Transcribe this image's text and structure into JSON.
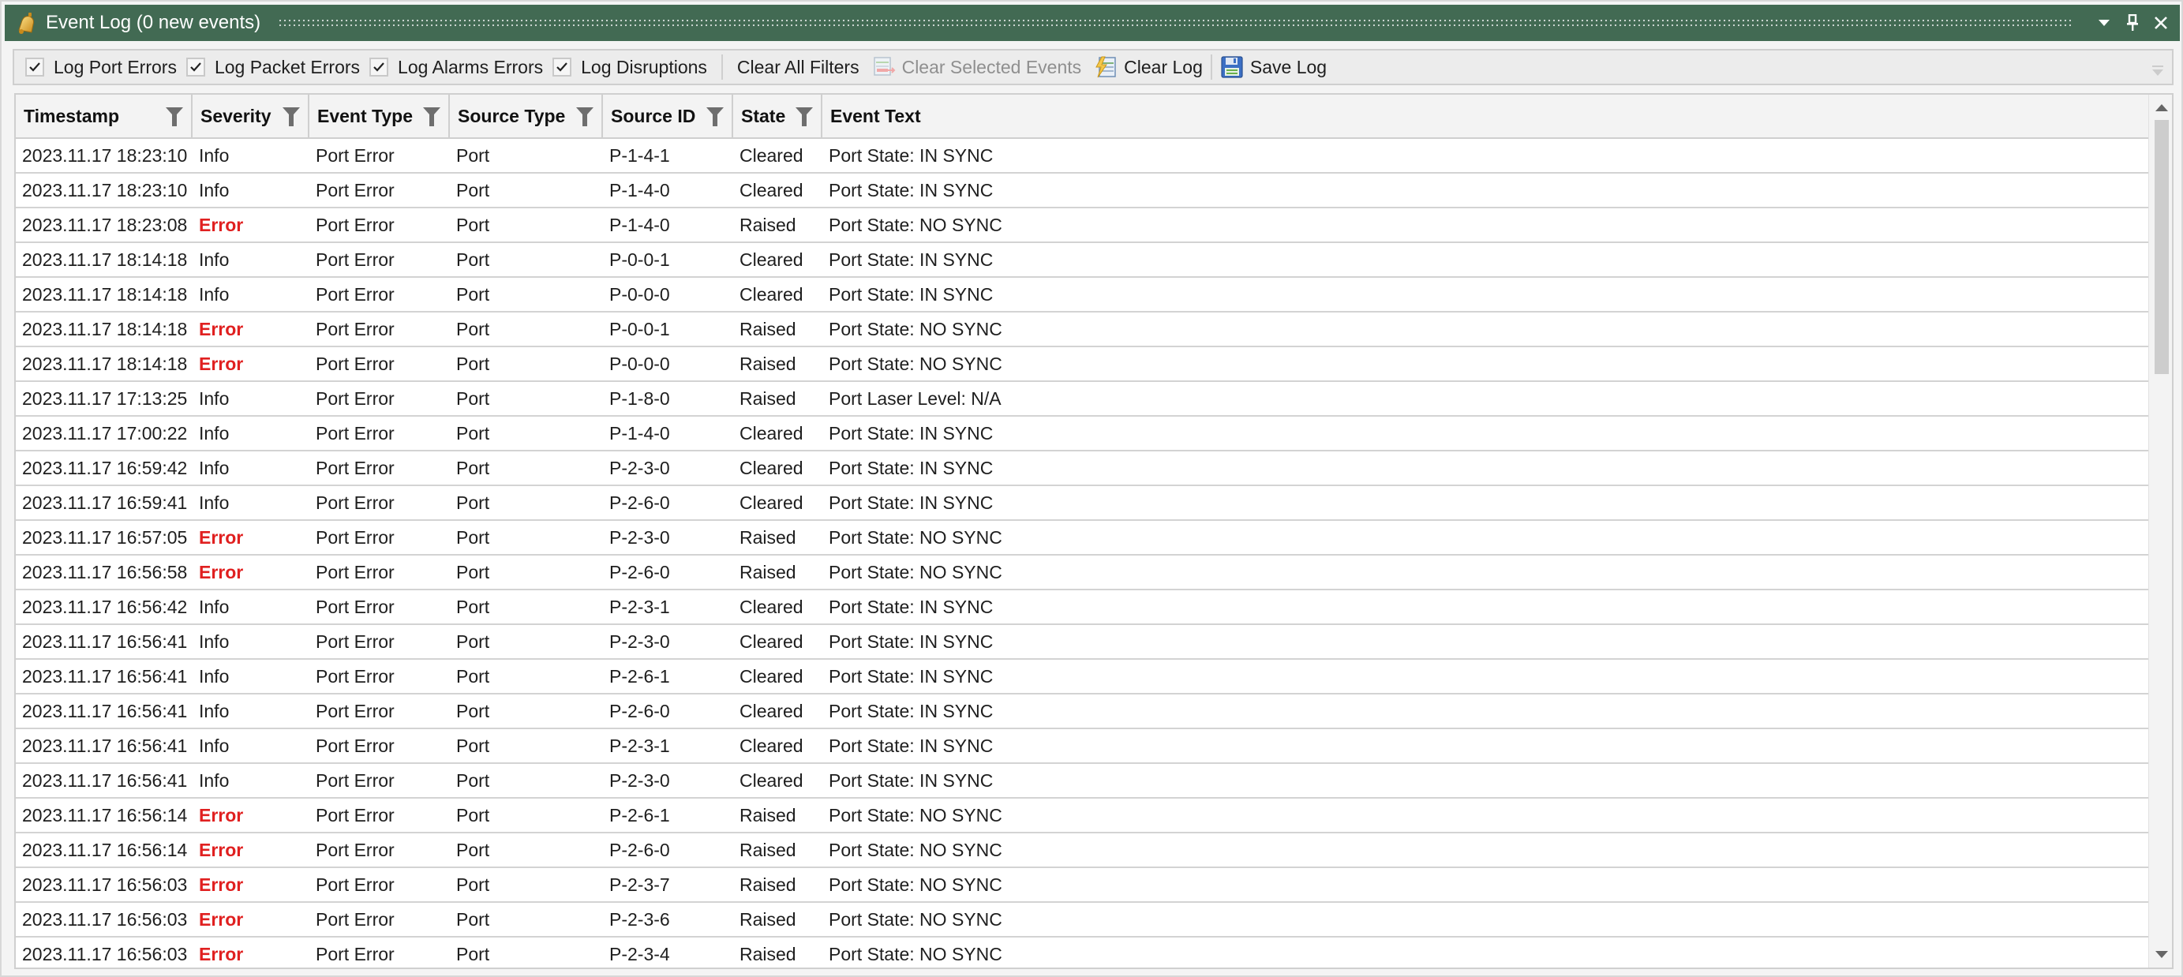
{
  "window": {
    "title": "Event Log (0 new events)",
    "title_icon": "bell-icon",
    "colors": {
      "titlebar": "#426a53",
      "error_text": "#e02020"
    }
  },
  "title_buttons": [
    {
      "name": "dropdown-button",
      "icon": "chevron-down-icon"
    },
    {
      "name": "pin-button",
      "icon": "pin-icon"
    },
    {
      "name": "close-button",
      "icon": "close-icon"
    }
  ],
  "toolbar": {
    "checkboxes": [
      {
        "label": "Log Port Errors",
        "checked": true
      },
      {
        "label": "Log Packet Errors",
        "checked": true
      },
      {
        "label": "Log Alarms Errors",
        "checked": true
      },
      {
        "label": "Log Disruptions",
        "checked": true
      }
    ],
    "clear_all_filters": "Clear All Filters",
    "clear_selected_events": "Clear Selected Events",
    "clear_selected_events_enabled": false,
    "clear_log": "Clear Log",
    "save_log": "Save Log"
  },
  "table": {
    "columns": [
      "Timestamp",
      "Severity",
      "Event Type",
      "Source Type",
      "Source ID",
      "State",
      "Event Text"
    ],
    "rows": [
      [
        "2023.11.17 18:23:10",
        "Info",
        "Port Error",
        "Port",
        "P-1-4-1",
        "Cleared",
        "Port State: IN SYNC"
      ],
      [
        "2023.11.17 18:23:10",
        "Info",
        "Port Error",
        "Port",
        "P-1-4-0",
        "Cleared",
        "Port State: IN SYNC"
      ],
      [
        "2023.11.17 18:23:08",
        "Error",
        "Port Error",
        "Port",
        "P-1-4-0",
        "Raised",
        "Port State: NO SYNC"
      ],
      [
        "2023.11.17 18:14:18",
        "Info",
        "Port Error",
        "Port",
        "P-0-0-1",
        "Cleared",
        "Port State: IN SYNC"
      ],
      [
        "2023.11.17 18:14:18",
        "Info",
        "Port Error",
        "Port",
        "P-0-0-0",
        "Cleared",
        "Port State: IN SYNC"
      ],
      [
        "2023.11.17 18:14:18",
        "Error",
        "Port Error",
        "Port",
        "P-0-0-1",
        "Raised",
        "Port State: NO SYNC"
      ],
      [
        "2023.11.17 18:14:18",
        "Error",
        "Port Error",
        "Port",
        "P-0-0-0",
        "Raised",
        "Port State: NO SYNC"
      ],
      [
        "2023.11.17 17:13:25",
        "Info",
        "Port Error",
        "Port",
        "P-1-8-0",
        "Raised",
        "Port Laser Level: N/A"
      ],
      [
        "2023.11.17 17:00:22",
        "Info",
        "Port Error",
        "Port",
        "P-1-4-0",
        "Cleared",
        "Port State: IN SYNC"
      ],
      [
        "2023.11.17 16:59:42",
        "Info",
        "Port Error",
        "Port",
        "P-2-3-0",
        "Cleared",
        "Port State: IN SYNC"
      ],
      [
        "2023.11.17 16:59:41",
        "Info",
        "Port Error",
        "Port",
        "P-2-6-0",
        "Cleared",
        "Port State: IN SYNC"
      ],
      [
        "2023.11.17 16:57:05",
        "Error",
        "Port Error",
        "Port",
        "P-2-3-0",
        "Raised",
        "Port State: NO SYNC"
      ],
      [
        "2023.11.17 16:56:58",
        "Error",
        "Port Error",
        "Port",
        "P-2-6-0",
        "Raised",
        "Port State: NO SYNC"
      ],
      [
        "2023.11.17 16:56:42",
        "Info",
        "Port Error",
        "Port",
        "P-2-3-1",
        "Cleared",
        "Port State: IN SYNC"
      ],
      [
        "2023.11.17 16:56:41",
        "Info",
        "Port Error",
        "Port",
        "P-2-3-0",
        "Cleared",
        "Port State: IN SYNC"
      ],
      [
        "2023.11.17 16:56:41",
        "Info",
        "Port Error",
        "Port",
        "P-2-6-1",
        "Cleared",
        "Port State: IN SYNC"
      ],
      [
        "2023.11.17 16:56:41",
        "Info",
        "Port Error",
        "Port",
        "P-2-6-0",
        "Cleared",
        "Port State: IN SYNC"
      ],
      [
        "2023.11.17 16:56:41",
        "Info",
        "Port Error",
        "Port",
        "P-2-3-1",
        "Cleared",
        "Port State: IN SYNC"
      ],
      [
        "2023.11.17 16:56:41",
        "Info",
        "Port Error",
        "Port",
        "P-2-3-0",
        "Cleared",
        "Port State: IN SYNC"
      ],
      [
        "2023.11.17 16:56:14",
        "Error",
        "Port Error",
        "Port",
        "P-2-6-1",
        "Raised",
        "Port State: NO SYNC"
      ],
      [
        "2023.11.17 16:56:14",
        "Error",
        "Port Error",
        "Port",
        "P-2-6-0",
        "Raised",
        "Port State: NO SYNC"
      ],
      [
        "2023.11.17 16:56:03",
        "Error",
        "Port Error",
        "Port",
        "P-2-3-7",
        "Raised",
        "Port State: NO SYNC"
      ],
      [
        "2023.11.17 16:56:03",
        "Error",
        "Port Error",
        "Port",
        "P-2-3-6",
        "Raised",
        "Port State: NO SYNC"
      ],
      [
        "2023.11.17 16:56:03",
        "Error",
        "Port Error",
        "Port",
        "P-2-3-4",
        "Raised",
        "Port State: NO SYNC"
      ]
    ]
  },
  "scrollbar": {
    "position_fraction": 0.0,
    "visible_fraction": 0.31
  }
}
